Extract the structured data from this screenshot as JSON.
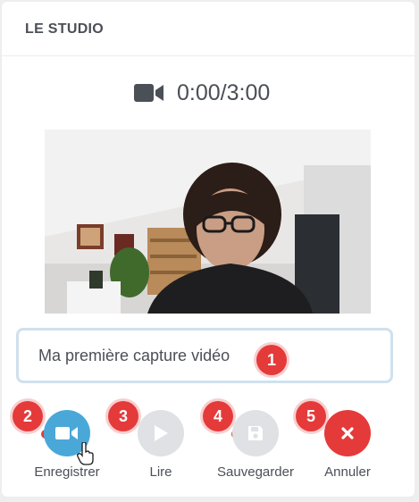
{
  "studio": {
    "title": "LE STUDIO",
    "timer": "0:00/3:00",
    "input_value": "Ma première capture vidéo",
    "actions": [
      {
        "label": "Enregistrer",
        "icon": "video-camera-icon",
        "badge": "2"
      },
      {
        "label": "Lire",
        "icon": "play-icon",
        "badge": "3"
      },
      {
        "label": "Sauvegarder",
        "icon": "floppy-disk-icon",
        "badge": "4"
      },
      {
        "label": "Annuler",
        "icon": "close-icon",
        "badge": "5"
      }
    ],
    "input_badge": "1"
  },
  "colors": {
    "record": "#4aa8d8",
    "disabled": "#dfe1e4",
    "cancel": "#e53a3a",
    "badge": "#e53a3a",
    "text": "#4b4f56"
  }
}
